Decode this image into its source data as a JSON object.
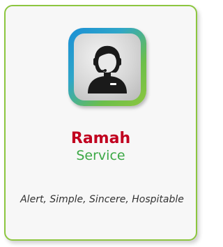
{
  "card": {
    "icon": "customer-service-agent-icon",
    "title": "Ramah",
    "subtitle": "Service",
    "description": "Alert, Simple, Sincere, Hospitable",
    "colors": {
      "border": "#8cc63f",
      "title": "#c1001f",
      "subtitle": "#3ba845",
      "icon_gradient_start": "#1a8fd6",
      "icon_gradient_end": "#8dc63f"
    }
  }
}
